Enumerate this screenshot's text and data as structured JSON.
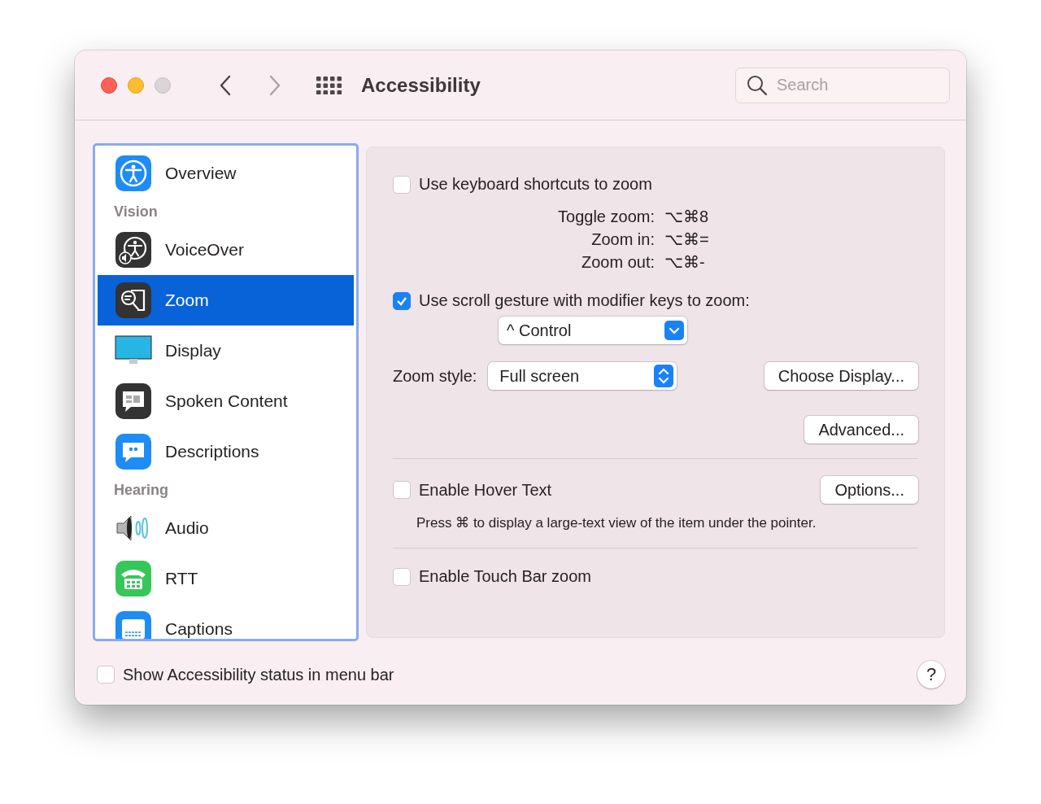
{
  "window": {
    "title": "Accessibility"
  },
  "search": {
    "placeholder": "Search"
  },
  "sidebar": {
    "items": [
      {
        "kind": "item",
        "label": "Overview",
        "selected": false
      },
      {
        "kind": "header",
        "label": "Vision"
      },
      {
        "kind": "item",
        "label": "VoiceOver",
        "selected": false
      },
      {
        "kind": "item",
        "label": "Zoom",
        "selected": true
      },
      {
        "kind": "item",
        "label": "Display",
        "selected": false
      },
      {
        "kind": "item",
        "label": "Spoken Content",
        "selected": false
      },
      {
        "kind": "item",
        "label": "Descriptions",
        "selected": false
      },
      {
        "kind": "header",
        "label": "Hearing"
      },
      {
        "kind": "item",
        "label": "Audio",
        "selected": false
      },
      {
        "kind": "item",
        "label": "RTT",
        "selected": false
      },
      {
        "kind": "item",
        "label": "Captions",
        "selected": false
      }
    ]
  },
  "zoom": {
    "keyboard_shortcuts": {
      "label": "Use keyboard shortcuts to zoom",
      "checked": false
    },
    "shortcuts": [
      {
        "label": "Toggle zoom:",
        "keys": "⌥⌘8"
      },
      {
        "label": "Zoom in:",
        "keys": "⌥⌘="
      },
      {
        "label": "Zoom out:",
        "keys": "⌥⌘-"
      }
    ],
    "scroll_gesture": {
      "label": "Use scroll gesture with modifier keys to zoom:",
      "checked": true
    },
    "modifier_select": {
      "value": "^ Control"
    },
    "zoom_style": {
      "label": "Zoom style:",
      "value": "Full screen"
    },
    "choose_display_button": "Choose Display...",
    "advanced_button": "Advanced...",
    "hover_text": {
      "label": "Enable Hover Text",
      "checked": false
    },
    "options_button": "Options...",
    "hover_hint": "Press ⌘ to display a large-text view of the item under the pointer.",
    "touch_bar": {
      "label": "Enable Touch Bar zoom",
      "checked": false
    }
  },
  "status_in_menu_bar": {
    "label": "Show Accessibility status in menu bar",
    "checked": false
  },
  "help_button": "?"
}
